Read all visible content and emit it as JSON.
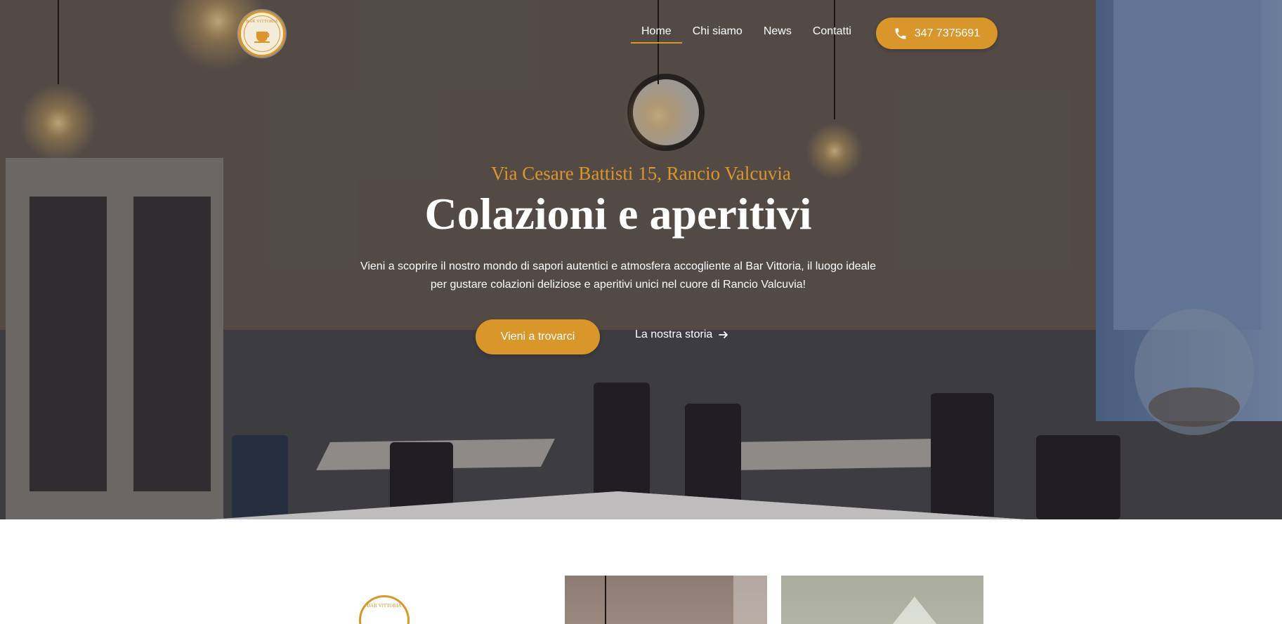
{
  "brand": {
    "logo_text": "BAR VITTORIA",
    "accent_color": "#d9962a"
  },
  "nav": {
    "items": [
      {
        "label": "Home",
        "active": true
      },
      {
        "label": "Chi siamo",
        "active": false
      },
      {
        "label": "News",
        "active": false
      },
      {
        "label": "Contatti",
        "active": false
      }
    ],
    "phone": {
      "icon": "phone-icon",
      "label": "347 7375691"
    }
  },
  "hero": {
    "address": "Via Cesare Battisti 15, Rancio Valcuvia",
    "headline": "Colazioni e aperitivi",
    "lead": "Vieni a scoprire il nostro mondo di sapori autentici e atmosfera accogliente al Bar Vittoria, il luogo ideale per gustare colazioni deliziose e aperitivi unici nel cuore di Rancio Valcuvia!",
    "cta_primary": "Vieni a trovarci",
    "cta_secondary": "La nostra storia",
    "cta_secondary_icon": "arrow-right-icon"
  },
  "section": {
    "logo_text": "BAR VITTORIA"
  }
}
